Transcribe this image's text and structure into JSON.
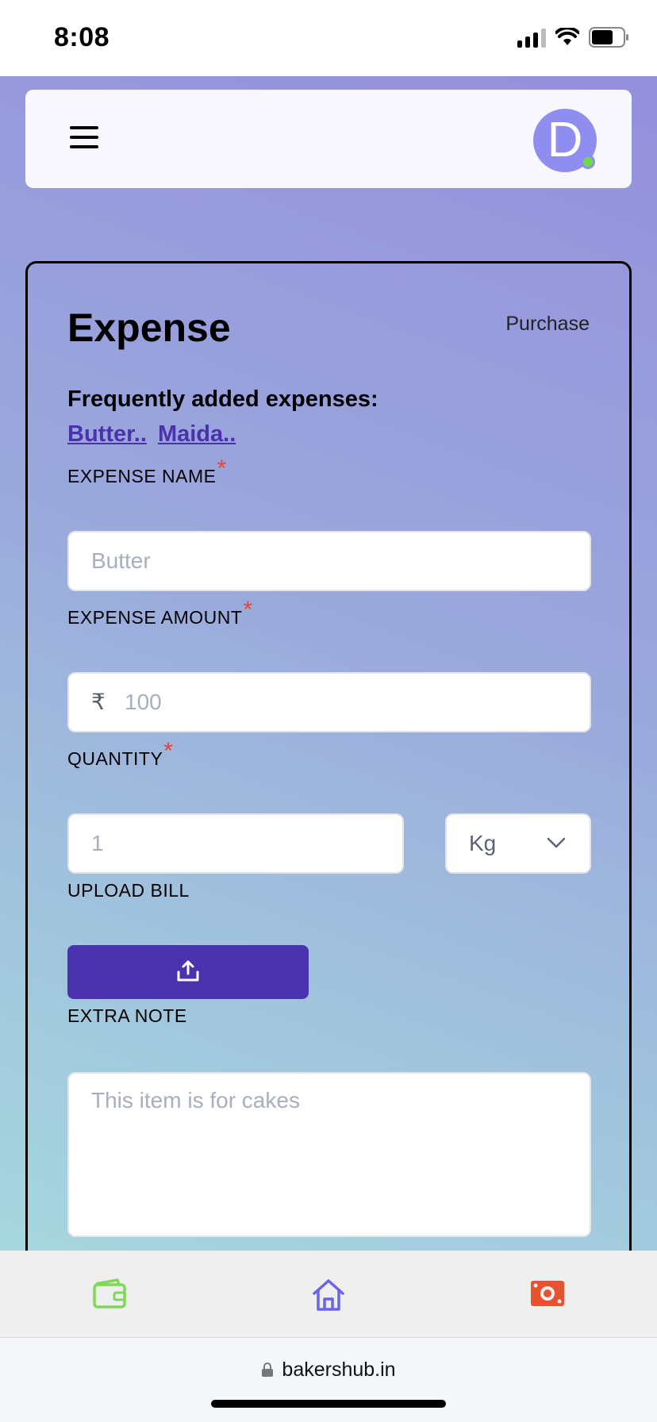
{
  "status_bar": {
    "time": "8:08"
  },
  "header": {
    "avatar_letter": "D"
  },
  "form": {
    "title": "Expense",
    "purchase_link": "Purchase",
    "frequent_label": "Frequently added expenses:",
    "frequent_items": [
      "Butter..",
      "Maida.."
    ],
    "expense_name": {
      "label": "EXPENSE NAME",
      "placeholder": "Butter"
    },
    "expense_amount": {
      "label": "EXPENSE AMOUNT",
      "currency_symbol": "₹",
      "placeholder": "100"
    },
    "quantity": {
      "label": "QUANTITY",
      "placeholder": "1",
      "unit_selected": "Kg"
    },
    "upload_bill": {
      "label": "UPLOAD BILL"
    },
    "extra_note": {
      "label": "EXTRA NOTE",
      "placeholder": "This item is for cakes"
    },
    "required_marker": "*"
  },
  "bottom_nav": {
    "items": [
      {
        "icon": "wallet-icon",
        "color": "#7ed957"
      },
      {
        "icon": "home-icon",
        "color": "#6a64e8"
      },
      {
        "icon": "cash-icon",
        "color": "#e8532f"
      }
    ]
  },
  "browser": {
    "url": "bakershub.in"
  },
  "colors": {
    "accent": "#4a31ae",
    "avatar": "#8f8ef0",
    "online_dot": "#6fdb4c",
    "required": "#e84434"
  }
}
